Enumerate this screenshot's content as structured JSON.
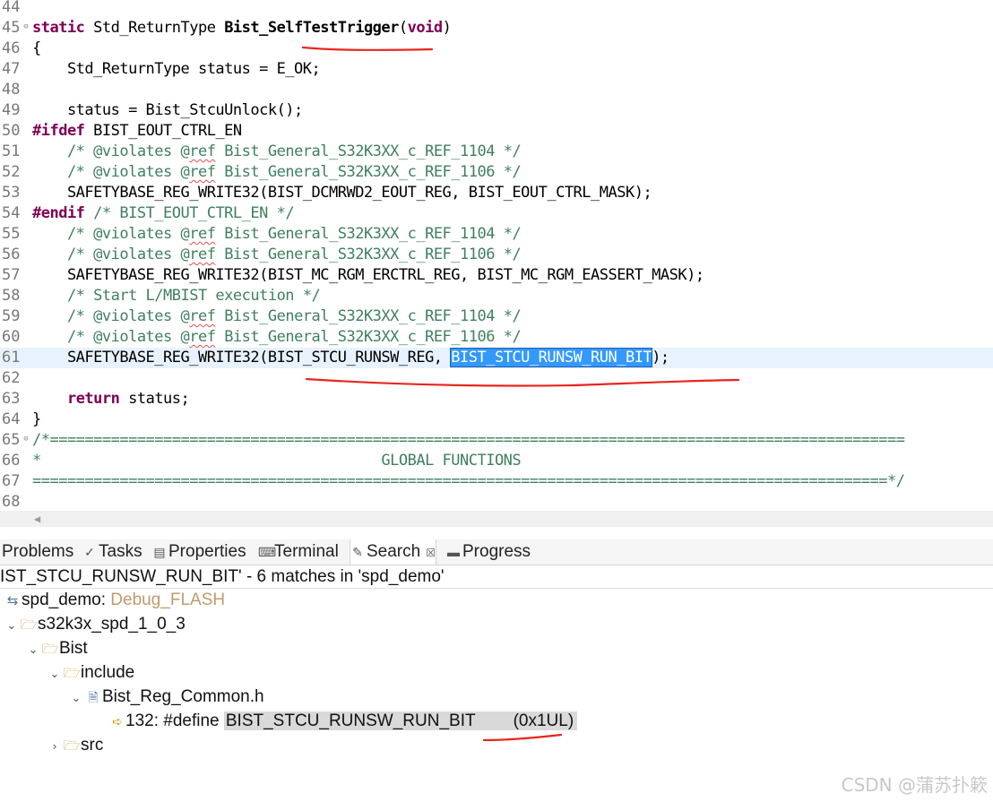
{
  "editor": {
    "lines": [
      {
        "n": "44",
        "fold": false,
        "segments": []
      },
      {
        "n": "45",
        "fold": true,
        "segments": [
          {
            "t": "static",
            "c": "kw"
          },
          {
            "t": " Std_ReturnType ",
            "c": ""
          },
          {
            "t": "Bist_SelfTestTrigger",
            "c": "fn"
          },
          {
            "t": "(",
            "c": ""
          },
          {
            "t": "void",
            "c": "kw"
          },
          {
            "t": ")",
            "c": ""
          }
        ]
      },
      {
        "n": "46",
        "fold": false,
        "segments": [
          {
            "t": "{",
            "c": ""
          }
        ]
      },
      {
        "n": "47",
        "fold": false,
        "segments": [
          {
            "t": "    Std_ReturnType status = E_OK;",
            "c": ""
          }
        ]
      },
      {
        "n": "48",
        "fold": false,
        "segments": []
      },
      {
        "n": "49",
        "fold": false,
        "segments": [
          {
            "t": "    status = Bist_StcuUnlock();",
            "c": ""
          }
        ]
      },
      {
        "n": "50",
        "fold": false,
        "segments": [
          {
            "t": "#ifdef",
            "c": "pp"
          },
          {
            "t": " BIST_EOUT_CTRL_EN",
            "c": ""
          }
        ]
      },
      {
        "n": "51",
        "fold": false,
        "segments": [
          {
            "t": "    /* @violates @",
            "c": "cm"
          },
          {
            "t": "ref",
            "c": "cm ref"
          },
          {
            "t": " Bist_General_S32K3XX_c_REF_1104 */",
            "c": "cm"
          }
        ]
      },
      {
        "n": "52",
        "fold": false,
        "segments": [
          {
            "t": "    /* @violates @",
            "c": "cm"
          },
          {
            "t": "ref",
            "c": "cm ref"
          },
          {
            "t": " Bist_General_S32K3XX_c_REF_1106 */",
            "c": "cm"
          }
        ]
      },
      {
        "n": "53",
        "fold": false,
        "segments": [
          {
            "t": "    SAFETYBASE_REG_WRITE32(BIST_DCMRWD2_EOUT_REG, BIST_EOUT_CTRL_MASK);",
            "c": ""
          }
        ]
      },
      {
        "n": "54",
        "fold": false,
        "segments": [
          {
            "t": "#endif",
            "c": "pp"
          },
          {
            "t": " /* BIST_EOUT_CTRL_EN */",
            "c": "cm"
          }
        ]
      },
      {
        "n": "55",
        "fold": false,
        "segments": [
          {
            "t": "    /* @violates @",
            "c": "cm"
          },
          {
            "t": "ref",
            "c": "cm ref"
          },
          {
            "t": " Bist_General_S32K3XX_c_REF_1104 */",
            "c": "cm"
          }
        ]
      },
      {
        "n": "56",
        "fold": false,
        "segments": [
          {
            "t": "    /* @violates @",
            "c": "cm"
          },
          {
            "t": "ref",
            "c": "cm ref"
          },
          {
            "t": " Bist_General_S32K3XX_c_REF_1106 */",
            "c": "cm"
          }
        ]
      },
      {
        "n": "57",
        "fold": false,
        "segments": [
          {
            "t": "    SAFETYBASE_REG_WRITE32(BIST_MC_RGM_ERCTRL_REG, BIST_MC_RGM_EASSERT_MASK);",
            "c": ""
          }
        ]
      },
      {
        "n": "58",
        "fold": false,
        "segments": [
          {
            "t": "    /* Start L/MBIST execution */",
            "c": "cm"
          }
        ]
      },
      {
        "n": "59",
        "fold": false,
        "segments": [
          {
            "t": "    /* @violates @",
            "c": "cm"
          },
          {
            "t": "ref",
            "c": "cm ref"
          },
          {
            "t": " Bist_General_S32K3XX_c_REF_1104 */",
            "c": "cm"
          }
        ]
      },
      {
        "n": "60",
        "fold": false,
        "segments": [
          {
            "t": "    /* @violates @",
            "c": "cm"
          },
          {
            "t": "ref",
            "c": "cm ref"
          },
          {
            "t": " Bist_General_S32K3XX_c_REF_1106 */",
            "c": "cm"
          }
        ]
      },
      {
        "n": "61",
        "fold": false,
        "current": true,
        "segments": [
          {
            "t": "    SAFETYBASE_REG_WRITE32(BIST_STCU_RUNSW_REG, ",
            "c": ""
          },
          {
            "t": "BIST_STCU_RUNSW_RUN_BIT",
            "c": "sel"
          },
          {
            "t": ");",
            "c": ""
          }
        ]
      },
      {
        "n": "62",
        "fold": false,
        "segments": []
      },
      {
        "n": "63",
        "fold": false,
        "segments": [
          {
            "t": "    ",
            "c": ""
          },
          {
            "t": "return",
            "c": "kw"
          },
          {
            "t": " status;",
            "c": ""
          }
        ]
      },
      {
        "n": "64",
        "fold": false,
        "segments": [
          {
            "t": "}",
            "c": ""
          }
        ]
      },
      {
        "n": "65",
        "fold": true,
        "segments": [
          {
            "t": "/*==================================================================================================",
            "c": "cm"
          }
        ]
      },
      {
        "n": "66",
        "fold": false,
        "segments": [
          {
            "t": "*                                       GLOBAL FUNCTIONS",
            "c": "cm"
          }
        ]
      },
      {
        "n": "67",
        "fold": false,
        "segments": [
          {
            "t": "==================================================================================================*/",
            "c": "cm"
          }
        ]
      },
      {
        "n": "68",
        "fold": false,
        "segments": []
      }
    ]
  },
  "tabs": [
    {
      "label": "Problems",
      "icon": "problems-icon",
      "glyph": "",
      "active": false
    },
    {
      "label": "Tasks",
      "icon": "tasks-icon",
      "glyph": "✓",
      "active": false
    },
    {
      "label": "Properties",
      "icon": "properties-icon",
      "glyph": "▤",
      "active": false
    },
    {
      "label": "Terminal",
      "icon": "terminal-icon",
      "glyph": "⌨",
      "active": false
    },
    {
      "label": "Search",
      "icon": "search-icon",
      "glyph": "✎",
      "active": true,
      "close": "☒"
    },
    {
      "label": "Progress",
      "icon": "progress-icon",
      "glyph": "▬",
      "active": false
    }
  ],
  "search": {
    "summary": "IST_STCU_RUNSW_RUN_BIT' - 6 matches in 'spd_demo'"
  },
  "tree": {
    "project": {
      "name": "spd_demo:",
      "config": "Debug_FLASH"
    },
    "sdk": "s32k3x_spd_1_0_3",
    "bist": "Bist",
    "include": "include",
    "file": "Bist_Reg_Common.h",
    "match": {
      "prefix": "132: #define ",
      "highlight": "BIST_STCU_RUNSW_RUN_BIT",
      "value": "(0x1UL)"
    },
    "src": "src"
  },
  "watermark": "CSDN @蒲苏扑簌"
}
